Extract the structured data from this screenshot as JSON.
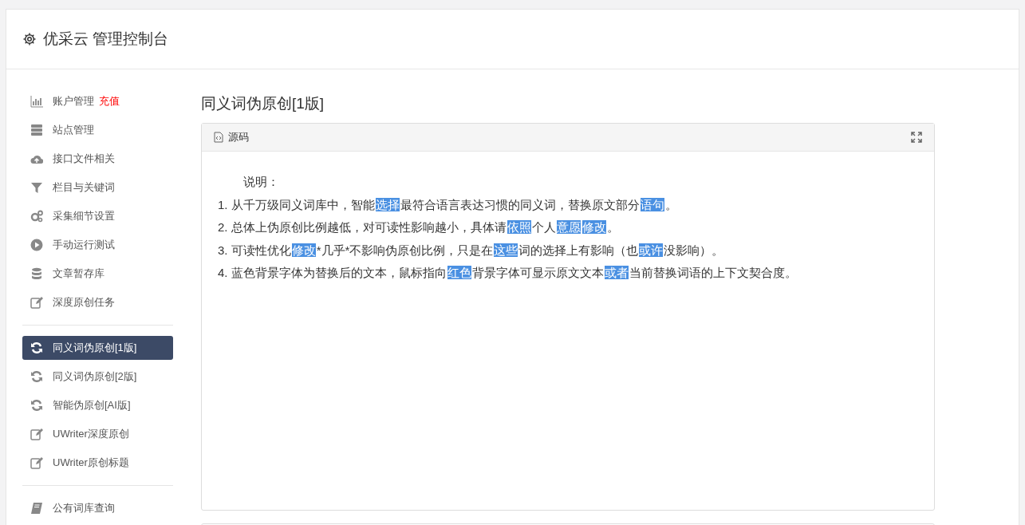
{
  "header": {
    "title": "优采云 管理控制台"
  },
  "sidebar": {
    "groups": [
      {
        "items": [
          {
            "label": "账户管理",
            "badge": "充值",
            "selected": false
          },
          {
            "label": "站点管理",
            "selected": false
          },
          {
            "label": "接口文件相关",
            "selected": false
          },
          {
            "label": "栏目与关键词",
            "selected": false
          },
          {
            "label": "采集细节设置",
            "selected": false
          },
          {
            "label": "手动运行测试",
            "selected": false
          },
          {
            "label": "文章暂存库",
            "selected": false
          },
          {
            "label": "深度原创任务",
            "selected": false
          }
        ]
      },
      {
        "items": [
          {
            "label": "同义词伪原创[1版]",
            "selected": true
          },
          {
            "label": "同义词伪原创[2版]",
            "selected": false
          },
          {
            "label": "智能伪原创[AI版]",
            "selected": false
          },
          {
            "label": "UWriter深度原创",
            "selected": false
          },
          {
            "label": "UWriter原创标题",
            "selected": false
          }
        ]
      },
      {
        "items": [
          {
            "label": "公有词库查询",
            "selected": false
          }
        ]
      }
    ]
  },
  "main": {
    "title": "同义词伪原创[1版]",
    "editor": {
      "tab": "源码",
      "heading": "说明：",
      "lines": [
        [
          {
            "text": "1. 从千万级同义词库中，智能",
            "highlighted": false
          },
          {
            "text": "选择",
            "highlighted": true
          },
          {
            "text": "最符合语言表达习惯的同义词，替换原文部分",
            "highlighted": false
          },
          {
            "text": "语句",
            "highlighted": true
          },
          {
            "text": "。",
            "highlighted": false
          }
        ],
        [
          {
            "text": "2. 总体上伪原创比例越低，对可读性影响越小，具体请",
            "highlighted": false
          },
          {
            "text": "依照",
            "highlighted": true
          },
          {
            "text": "个人",
            "highlighted": false
          },
          {
            "text": "意愿",
            "highlighted": true
          },
          {
            "text": "修改",
            "highlighted": true
          },
          {
            "text": "。",
            "highlighted": false
          }
        ],
        [
          {
            "text": "3. 可读性优化",
            "highlighted": false
          },
          {
            "text": "修改",
            "highlighted": true
          },
          {
            "text": "*几乎*不影响伪原创比例，只是在",
            "highlighted": false
          },
          {
            "text": "这些",
            "highlighted": true
          },
          {
            "text": "词的选择上有影响（也",
            "highlighted": false
          },
          {
            "text": "或许",
            "highlighted": true
          },
          {
            "text": "没影响）。",
            "highlighted": false
          }
        ],
        [
          {
            "text": "4. 蓝色背景字体为替换后的文本，鼠标指向",
            "highlighted": false
          },
          {
            "text": "红色",
            "highlighted": true
          },
          {
            "text": "背景字体可显示原文文本",
            "highlighted": false
          },
          {
            "text": "或者",
            "highlighted": true
          },
          {
            "text": "当前替换词语的上下文契合度。",
            "highlighted": false
          }
        ]
      ]
    }
  }
}
